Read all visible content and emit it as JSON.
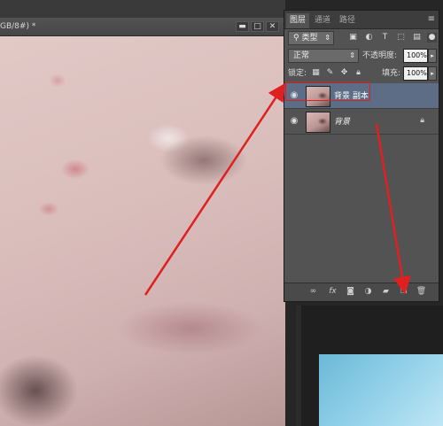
{
  "document": {
    "title": "GB/8#) *",
    "minimize_glyph": "▬",
    "maximize_glyph": "□",
    "close_glyph": "✕"
  },
  "layers_panel": {
    "tabs": [
      {
        "label": "图层",
        "active": true
      },
      {
        "label": "通道",
        "active": false
      },
      {
        "label": "路径",
        "active": false
      }
    ],
    "filter_kind": "类型",
    "blend_mode": "正常",
    "opacity_label": "不透明度:",
    "opacity_value": "100%",
    "lock_label": "锁定:",
    "fill_label": "填充:",
    "fill_value": "100%",
    "layers": [
      {
        "name": "背景 副本",
        "visible": true,
        "selected": true,
        "locked": false
      },
      {
        "name": "背景",
        "visible": true,
        "selected": false,
        "locked": true
      }
    ],
    "bottom_icons": [
      "link-icon",
      "fx-icon",
      "mask-icon",
      "adjustment-icon",
      "group-folder-icon",
      "new-layer-icon",
      "trash-icon"
    ]
  },
  "colors": {
    "panel_bg": "#535353",
    "selected_layer": "#5d6d86",
    "annotation_red": "#e02020"
  }
}
